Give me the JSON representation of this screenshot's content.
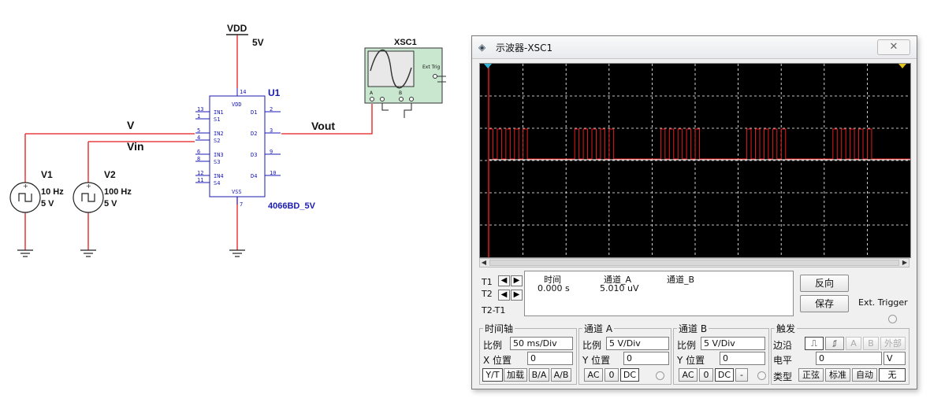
{
  "schematic": {
    "vdd": {
      "name": "VDD",
      "value": "5V"
    },
    "v1": {
      "name": "V1",
      "freq": "10 Hz",
      "amp": "5 V"
    },
    "v2": {
      "name": "V2",
      "freq": "100 Hz",
      "amp": "5 V"
    },
    "net_v": "V",
    "net_vin": "Vin",
    "net_vout": "Vout",
    "ic": {
      "ref": "U1",
      "part": "4066BD_5V",
      "vdd_label": "VDD",
      "vss_label": "VSS",
      "pin_vdd": "14",
      "pin_vss": "7",
      "left_pins": [
        {
          "num_a": "13",
          "num_b": "1",
          "in": "IN1",
          "s": "S1"
        },
        {
          "num_a": "5",
          "num_b": "4",
          "in": "IN2",
          "s": "S2"
        },
        {
          "num_a": "6",
          "num_b": "8",
          "in": "IN3",
          "s": "S3"
        },
        {
          "num_a": "12",
          "num_b": "11",
          "in": "IN4",
          "s": "S4"
        }
      ],
      "right_pins": [
        {
          "num": "2",
          "d": "D1"
        },
        {
          "num": "3",
          "d": "D2"
        },
        {
          "num": "9",
          "d": "D3"
        },
        {
          "num": "10",
          "d": "D4"
        }
      ]
    },
    "scope_symbol": {
      "name": "XSC1",
      "ext_trig": "Ext Trig",
      "ch_a": "A",
      "ch_b": "B"
    }
  },
  "window": {
    "title": "示波器-XSC1",
    "close": "✕"
  },
  "colors": {
    "trace_a": "#e31b1b",
    "trace_b": "#ffffff",
    "wire": "#e31b1b",
    "ic_blue": "#1a1ab4"
  },
  "chart_data": {
    "type": "line",
    "description": "oscilloscope trace",
    "time_div": "50 ms/Div",
    "volt_div": "5 V/Div",
    "divisions_x": 10,
    "divisions_y": 6,
    "series": [
      {
        "name": "通道_A",
        "signal": "100 Hz gated by 10 Hz, 0 to 5 V"
      },
      {
        "name": "通道_B",
        "signal": "0 V"
      }
    ]
  },
  "cursor": {
    "t1": "T1",
    "t2": "T2",
    "t2t1": "T2-T1",
    "headers": [
      "时间",
      "通道_A",
      "通道_B"
    ],
    "values": [
      "0.000 s",
      "5.010 uV",
      ""
    ]
  },
  "buttons": {
    "reverse": "反向",
    "save": "保存",
    "ext_trigger": "Ext. Trigger"
  },
  "timebase": {
    "title": "时间轴",
    "scale_label": "比例",
    "scale": "50 ms/Div",
    "xpos_label": "X 位置",
    "xpos": "0",
    "modes": [
      "Y/T",
      "加载",
      "B/A",
      "A/B"
    ]
  },
  "channel_a": {
    "title": "通道 A",
    "scale_label": "比例",
    "scale": "5  V/Div",
    "ypos_label": "Y 位置",
    "ypos": "0",
    "coupling": [
      "AC",
      "0",
      "DC"
    ]
  },
  "channel_b": {
    "title": "通道 B",
    "scale_label": "比例",
    "scale": "5  V/Div",
    "ypos_label": "Y 位置",
    "ypos": "0",
    "coupling": [
      "AC",
      "0",
      "DC",
      "-"
    ]
  },
  "trigger": {
    "title": "触发",
    "edge_label": "边沿",
    "level_label": "电平",
    "level": "0",
    "level_unit": "V",
    "sources": [
      "A",
      "B",
      "外部"
    ],
    "type_label": "类型",
    "types": [
      "正弦",
      "标准",
      "自动",
      "无"
    ]
  }
}
